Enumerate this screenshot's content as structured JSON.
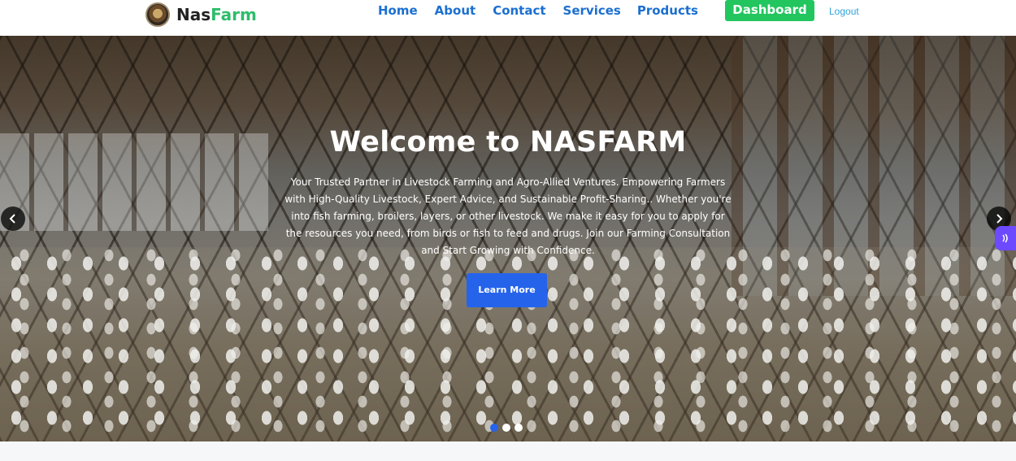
{
  "header": {
    "logo": {
      "part1": "Nas",
      "part2": "Farm"
    },
    "nav": [
      {
        "label": "Home"
      },
      {
        "label": "About"
      },
      {
        "label": "Contact"
      },
      {
        "label": "Services"
      },
      {
        "label": "Products"
      }
    ],
    "dashboard_label": "Dashboard",
    "logout_label": "Logout"
  },
  "hero": {
    "title": "Welcome to NASFARM",
    "description": "Your Trusted Partner in Livestock Farming and Agro-Allied Ventures. Empowering Farmers with High-Quality Livestock, Expert Advice, and Sustainable Profit-Sharing.. Whether you're into fish farming, broilers, layers, or other livestock. We make it easy for you to apply for the resources you need, from birds or fish to feed and drugs. Join our Farming Consultation and Start Growing with Confidence.",
    "button_label": "Learn More",
    "carousel": {
      "slide_count": 3,
      "active_index": 0
    }
  },
  "colors": {
    "nav_link": "#1b6fd0",
    "brand_green": "#2ebd6b",
    "dashboard_button": "#22c55e",
    "learn_more_button": "#2563eb",
    "logout_link": "#2fa4d9",
    "widget": "#6d4aff"
  },
  "icons": {
    "prev": "chevron-left-icon",
    "next": "chevron-right-icon",
    "widget": "chat-widget-icon"
  }
}
